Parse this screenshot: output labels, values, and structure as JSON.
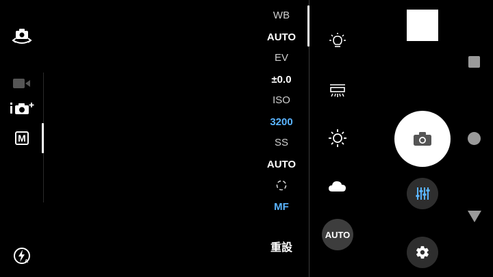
{
  "left_rail": {
    "modes": [
      {
        "icon": "camera-switch-icon"
      },
      {
        "icon": "video-camera-icon"
      },
      {
        "icon": "camera-plus-icon",
        "text": "i",
        "sup": "+"
      },
      {
        "icon": "manual-mode-icon",
        "text": "M"
      }
    ],
    "flash": {
      "icon": "flash-auto-icon"
    }
  },
  "settings": {
    "wb_label": "WB",
    "wb_value": "AUTO",
    "ev_label": "EV",
    "ev_value": "±0.0",
    "iso_label": "ISO",
    "iso_value": "3200",
    "ss_label": "SS",
    "ss_value": "AUTO",
    "focus_value": "MF",
    "reset_label": "重設"
  },
  "wb_options": [
    {
      "icon": "incandescent-icon"
    },
    {
      "icon": "fluorescent-icon"
    },
    {
      "icon": "daylight-icon"
    },
    {
      "icon": "cloudy-icon"
    },
    {
      "label": "AUTO"
    }
  ],
  "right_controls": {
    "shutter_icon": "camera-icon",
    "adjust_icon": "sliders-icon",
    "settings_icon": "gear-icon"
  },
  "nav": {
    "recents": "square-icon",
    "home": "circle-icon",
    "back": "triangle-icon"
  },
  "colors": {
    "accent": "#5ab4ff",
    "background": "#000000"
  }
}
